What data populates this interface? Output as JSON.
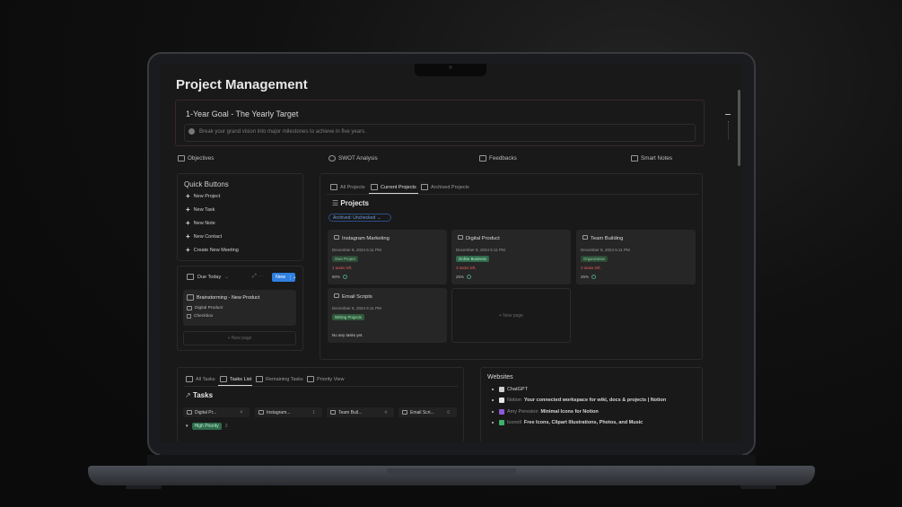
{
  "page": {
    "title": "Project Management",
    "goal": {
      "title": "1-Year Goal - The Yearly Target",
      "description": "Break your grand vision into major milestones to achieve in five years."
    },
    "nav": [
      {
        "label": "Objectives"
      },
      {
        "label": "SWOT Analysis"
      },
      {
        "label": "Feedbacks"
      },
      {
        "label": "Smart Notes"
      }
    ]
  },
  "quick_buttons": {
    "title": "Quick Buttons",
    "items": [
      "New Project",
      "New Task",
      "New Note",
      "New Contact",
      "Create New Meeting"
    ]
  },
  "due_today": {
    "label": "Due Today",
    "new_label": "New",
    "card": {
      "title": "Brainstorming - New Product",
      "project": "Digital Product",
      "checkbox": "Checkbox"
    },
    "new_page": "+ New page"
  },
  "projects_view": {
    "tabs": [
      "All Projects",
      "Current Projects",
      "Archived Projects"
    ],
    "title": "Projects",
    "filter": "Archived: Unchecked",
    "cards": [
      {
        "name": "Instagram Marketing",
        "date": "December 8, 2024 5:11 PM",
        "tag": "Own Project",
        "tag_color": "#2d4a36",
        "tasks_left": "1 tasks left.",
        "percent": "80%"
      },
      {
        "name": "Digital Product",
        "date": "December 8, 2024 5:11 PM",
        "tag": "Online Business",
        "tag_color": "#2f6a4c",
        "tasks_left": "3 tasks left.",
        "percent": "25%"
      },
      {
        "name": "Team Building",
        "date": "December 8, 2024 5:11 PM",
        "tag": "Organization",
        "tag_color": "#2c4a36",
        "tasks_left": "3 tasks left.",
        "percent": "25%"
      },
      {
        "name": "Email Scripts",
        "date": "December 8, 2024 5:11 PM",
        "tag": "Writing Projects",
        "tag_color": "#305a3c",
        "no_tasks": "No any tasks yet."
      }
    ],
    "new_page": "+ New page"
  },
  "tasks_view": {
    "tabs": [
      "All Tasks",
      "Tasks List",
      "Remaining Tasks",
      "Priority View"
    ],
    "title": "Tasks",
    "groups": [
      {
        "label": "Digital Pr...",
        "count": "4"
      },
      {
        "label": "Instagram...",
        "count": "1"
      },
      {
        "label": "Team Buil...",
        "count": "4"
      },
      {
        "label": "Email Scri...",
        "count": "0"
      }
    ],
    "priority": {
      "label": "High Priority",
      "count": "3"
    }
  },
  "websites": {
    "title": "Websites",
    "items": [
      {
        "name": "ChatGPT",
        "desc": "",
        "color": "#cfcfcf"
      },
      {
        "name": "Notion",
        "desc": "Your connected workspace for wiki, docs & projects | Notion",
        "color": "#e6e6e6"
      },
      {
        "name": "Amy Pereston",
        "desc": "Minimal Icons for Notion",
        "color": "#8a5ad8"
      },
      {
        "name": "Iconoll",
        "desc": "Free Icons, Clipart Illustrations, Photos, and Music",
        "color": "#3bb36b"
      }
    ]
  }
}
